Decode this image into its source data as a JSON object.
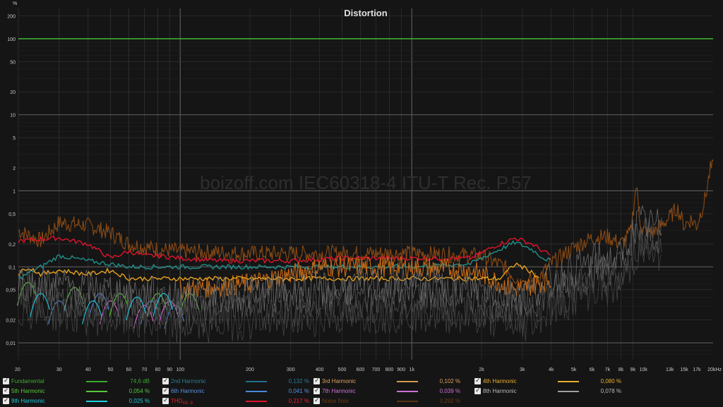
{
  "chart_data": {
    "type": "line",
    "title": "Distortion",
    "watermark": "boizoff.com IEC60318-4 ITU-T Rec. P.57",
    "y_unit": "%",
    "x_scale": "log",
    "y_scale": "log",
    "xlim": [
      20,
      20000
    ],
    "ylim": [
      0.006,
      250
    ],
    "grid": true,
    "x_ticks": [
      {
        "v": 20,
        "t": "20"
      },
      {
        "v": 30,
        "t": "30"
      },
      {
        "v": 40,
        "t": "40"
      },
      {
        "v": 50,
        "t": "50"
      },
      {
        "v": 60,
        "t": "60"
      },
      {
        "v": 70,
        "t": "70"
      },
      {
        "v": 80,
        "t": "80"
      },
      {
        "v": 90,
        "t": "90"
      },
      {
        "v": 100,
        "t": "100"
      },
      {
        "v": 200,
        "t": "200"
      },
      {
        "v": 300,
        "t": "300"
      },
      {
        "v": 400,
        "t": "400"
      },
      {
        "v": 500,
        "t": "500"
      },
      {
        "v": 600,
        "t": "600"
      },
      {
        "v": 700,
        "t": "700"
      },
      {
        "v": 800,
        "t": "800"
      },
      {
        "v": 900,
        "t": "900"
      },
      {
        "v": 1000,
        "t": "1k"
      },
      {
        "v": 2000,
        "t": "2k"
      },
      {
        "v": 3000,
        "t": "3k"
      },
      {
        "v": 4000,
        "t": "4k"
      },
      {
        "v": 5000,
        "t": "5k"
      },
      {
        "v": 6000,
        "t": "6k"
      },
      {
        "v": 7000,
        "t": "7k"
      },
      {
        "v": 8000,
        "t": "8k"
      },
      {
        "v": 9000,
        "t": "9k"
      },
      {
        "v": 10000,
        "t": "10k"
      },
      {
        "v": 13000,
        "t": "13k"
      },
      {
        "v": 15000,
        "t": "15k"
      },
      {
        "v": 17000,
        "t": "17k"
      },
      {
        "v": 20000,
        "t": "20kHz"
      }
    ],
    "y_ticks": [
      {
        "v": 200,
        "t": "200"
      },
      {
        "v": 100,
        "t": "100"
      },
      {
        "v": 50,
        "t": "50"
      },
      {
        "v": 20,
        "t": "20"
      },
      {
        "v": 10,
        "t": "10"
      },
      {
        "v": 5,
        "t": "5"
      },
      {
        "v": 2,
        "t": "2"
      },
      {
        "v": 1,
        "t": "1"
      },
      {
        "v": 0.5,
        "t": "0,5"
      },
      {
        "v": 0.2,
        "t": "0,2"
      },
      {
        "v": 0.1,
        "t": "0,1"
      },
      {
        "v": 0.05,
        "t": "0,05"
      },
      {
        "v": 0.02,
        "t": "0,02"
      },
      {
        "v": 0.01,
        "t": "0,01"
      }
    ],
    "series": [
      {
        "name": "Fundamental",
        "value": "74,6 dB",
        "color": "#3aa82e",
        "style": "flat",
        "y": 100
      },
      {
        "name": "Noise floor",
        "value": "0,292 %",
        "color": "#8b4a14",
        "style": "noise",
        "points": [
          [
            20,
            0.3
          ],
          [
            25,
            0.22
          ],
          [
            30,
            0.38
          ],
          [
            40,
            0.35
          ],
          [
            50,
            0.28
          ],
          [
            60,
            0.2
          ],
          [
            80,
            0.17
          ],
          [
            100,
            0.16
          ],
          [
            200,
            0.15
          ],
          [
            400,
            0.15
          ],
          [
            1000,
            0.15
          ],
          [
            2000,
            0.14
          ],
          [
            2500,
            0.1
          ],
          [
            3000,
            0.06
          ],
          [
            3500,
            0.07
          ],
          [
            4000,
            0.11
          ],
          [
            5000,
            0.18
          ],
          [
            6000,
            0.24
          ],
          [
            7000,
            0.25
          ],
          [
            8000,
            0.2
          ],
          [
            8800,
            0.28
          ],
          [
            9300,
            1.2
          ],
          [
            9800,
            0.3
          ],
          [
            11000,
            0.28
          ],
          [
            13000,
            0.45
          ],
          [
            14000,
            0.6
          ],
          [
            15000,
            0.35
          ],
          [
            16000,
            0.42
          ],
          [
            17000,
            0.35
          ],
          [
            18500,
            0.8
          ],
          [
            19500,
            2.0
          ],
          [
            20000,
            2.0
          ]
        ]
      },
      {
        "name": "THD",
        "sub": "H2..9",
        "value": "0,217 %",
        "color": "#e0142c",
        "style": "smooth",
        "points": [
          [
            20,
            0.22
          ],
          [
            30,
            0.24
          ],
          [
            40,
            0.2
          ],
          [
            50,
            0.13
          ],
          [
            60,
            0.16
          ],
          [
            70,
            0.14
          ],
          [
            80,
            0.14
          ],
          [
            100,
            0.13
          ],
          [
            150,
            0.12
          ],
          [
            200,
            0.12
          ],
          [
            300,
            0.12
          ],
          [
            500,
            0.13
          ],
          [
            1000,
            0.13
          ],
          [
            1800,
            0.13
          ],
          [
            2300,
            0.19
          ],
          [
            2800,
            0.24
          ],
          [
            3300,
            0.2
          ],
          [
            3700,
            0.16
          ],
          [
            4000,
            0.14
          ]
        ]
      },
      {
        "name": "2nd Harmonic",
        "value": "0,132 %",
        "color": "#1f8f8a",
        "style": "smooth",
        "points": [
          [
            20,
            0.07
          ],
          [
            25,
            0.1
          ],
          [
            30,
            0.14
          ],
          [
            40,
            0.12
          ],
          [
            60,
            0.1
          ],
          [
            100,
            0.1
          ],
          [
            200,
            0.1
          ],
          [
            500,
            0.1
          ],
          [
            1000,
            0.1
          ],
          [
            1800,
            0.11
          ],
          [
            2300,
            0.16
          ],
          [
            2800,
            0.21
          ],
          [
            3300,
            0.17
          ],
          [
            3700,
            0.13
          ],
          [
            4000,
            0.12
          ]
        ]
      },
      {
        "name": "3rd Harmonic",
        "value": "0,102 %",
        "color": "#c86a14",
        "style": "noise",
        "points": [
          [
            100,
            0.05
          ],
          [
            200,
            0.06
          ],
          [
            300,
            0.08
          ],
          [
            400,
            0.1
          ],
          [
            1000,
            0.1
          ],
          [
            1800,
            0.09
          ],
          [
            2200,
            0.07
          ],
          [
            2800,
            0.05
          ],
          [
            3500,
            0.06
          ],
          [
            4000,
            0.07
          ]
        ]
      },
      {
        "name": "4th Harmonic",
        "value": "0,080 %",
        "color": "#e8a21c",
        "style": "smooth",
        "points": [
          [
            20,
            0.08
          ],
          [
            22,
            0.1
          ],
          [
            25,
            0.08
          ],
          [
            30,
            0.09
          ],
          [
            40,
            0.08
          ],
          [
            50,
            0.09
          ],
          [
            60,
            0.07
          ],
          [
            2400,
            0.07
          ],
          [
            2800,
            0.11
          ],
          [
            3200,
            0.09
          ],
          [
            3600,
            0.07
          ]
        ]
      },
      {
        "name": "5th Harmonic",
        "value": "0,054 %",
        "color": "#58b83c",
        "style": "blip",
        "points": [
          [
            22,
            0.07
          ],
          [
            35,
            0.06
          ],
          [
            55,
            0.05
          ],
          [
            80,
            0.05
          ],
          [
            110,
            0.05
          ]
        ]
      },
      {
        "name": "6th Harmonic",
        "value": "0,041 %",
        "color": "#4a78c8",
        "style": "blip",
        "points": [
          [
            30,
            0.04
          ],
          [
            45,
            0.05
          ],
          [
            75,
            0.04
          ],
          [
            95,
            0.035
          ]
        ]
      },
      {
        "name": "7th Harmonic",
        "value": "0,039 %",
        "color": "#c95cc8",
        "style": "blip",
        "points": [
          [
            50,
            0.04
          ],
          [
            70,
            0.035
          ],
          [
            90,
            0.04
          ]
        ]
      },
      {
        "name": "8th Harmonic",
        "value": "0,078 %",
        "color": "#8a8a8a",
        "style": "grey",
        "points": [
          [
            20,
            0.05
          ],
          [
            40,
            0.04
          ],
          [
            100,
            0.03
          ],
          [
            200,
            0.035
          ],
          [
            500,
            0.04
          ],
          [
            1000,
            0.045
          ],
          [
            2000,
            0.04
          ],
          [
            3000,
            0.03
          ],
          [
            4000,
            0.05
          ],
          [
            6000,
            0.09
          ],
          [
            8000,
            0.1
          ],
          [
            9500,
            0.3
          ],
          [
            12000,
            0.25
          ]
        ]
      },
      {
        "name": "9th Harmonic",
        "value": "0,025 %",
        "color": "#1fb6c8",
        "style": "blip",
        "points": [
          [
            25,
            0.05
          ],
          [
            42,
            0.04
          ],
          [
            65,
            0.045
          ],
          [
            85,
            0.05
          ]
        ]
      }
    ]
  },
  "legend": [
    {
      "name": "Fundamental",
      "value": "74,6 dB",
      "color": "#3aa82e",
      "text_color": "#3aa82e",
      "val_color": "#3aa82e"
    },
    {
      "name": "2nd Harmonic",
      "value": "0,132 %",
      "color": "#1f6f8a",
      "text_color": "#2a7d96",
      "val_color": "#2a7d96"
    },
    {
      "name": "3rd Harmonic",
      "value": "0,102 %",
      "color": "#d89a4c",
      "text_color": "#e0a05a",
      "val_color": "#e0a05a"
    },
    {
      "name": "4th Harmonic",
      "value": "0,080 %",
      "color": "#e8b030",
      "text_color": "#e8b030",
      "val_color": "#e8b030"
    },
    {
      "name": "5th Harmonic",
      "value": "0,054 %",
      "color": "#58c83c",
      "text_color": "#58c83c",
      "val_color": "#58c83c"
    },
    {
      "name": "6th Harmonic",
      "value": "0,041 %",
      "color": "#4a88d8",
      "text_color": "#5a90e0",
      "val_color": "#5a90e0"
    },
    {
      "name": "7th Harmonic",
      "value": "0,039 %",
      "color": "#d070d8",
      "text_color": "#d070d8",
      "val_color": "#d070d8"
    },
    {
      "name": "8th Harmonic",
      "value": "0,078 %",
      "color": "#a0a0a0",
      "text_color": "#b8b8b8",
      "val_color": "#b8b8b8"
    },
    {
      "name": "9th Harmonic",
      "value": "0,025 %",
      "color": "#1fd0e0",
      "text_color": "#20c8d8",
      "val_color": "#20c8d8"
    },
    {
      "name": "THD",
      "sub": "H2..9",
      "value": "0,217 %",
      "color": "#e0142c",
      "text_color": "#e82030",
      "val_color": "#e82030"
    },
    {
      "name": "Noise floor",
      "value": "0,292 %",
      "color": "#5a3414",
      "text_color": "#6a3a18",
      "val_color": "#6a3a18"
    }
  ]
}
